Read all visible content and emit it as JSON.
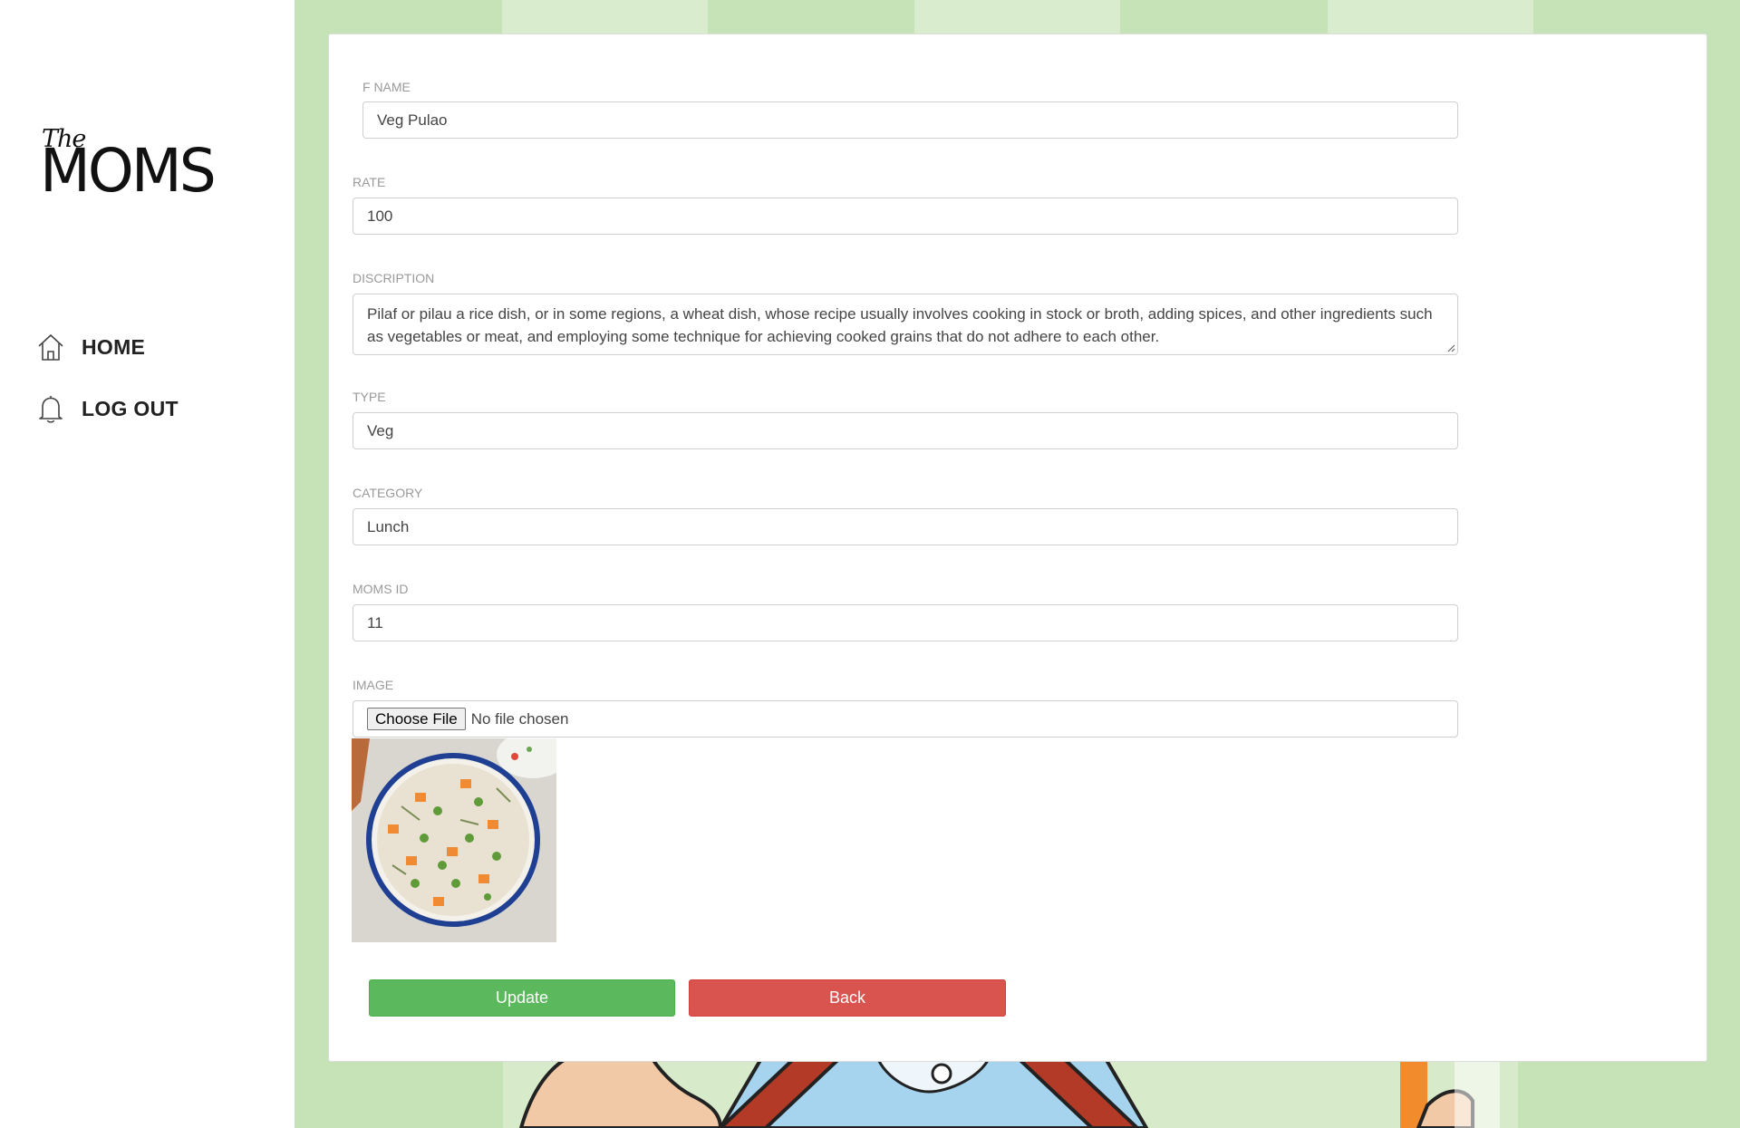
{
  "brand": {
    "logo_small": "The",
    "logo_main": "MOMS"
  },
  "nav": {
    "items": [
      {
        "label": "HOME",
        "icon": "home-icon"
      },
      {
        "label": "LOG OUT",
        "icon": "bell-icon"
      }
    ]
  },
  "form": {
    "fname_label": "F NAME",
    "fname_value": "Veg Pulao",
    "rate_label": "RATE",
    "rate_value": "100",
    "description_label": "DISCRIPTION",
    "description_value": "Pilaf or pilau a rice dish, or in some regions, a wheat dish, whose recipe usually involves cooking in stock or broth, adding spices, and other ingredients such as vegetables or meat, and employing some technique for achieving cooked grains that do not adhere to each other.",
    "type_label": "TYPE",
    "type_value": "Veg",
    "category_label": "CATEGORY",
    "category_value": "Lunch",
    "moms_id_label": "MOMS ID",
    "moms_id_value": "11",
    "image_label": "IMAGE",
    "file_button": "Choose File",
    "file_status": "No file chosen",
    "update_button": "Update",
    "back_button": "Back"
  },
  "colors": {
    "background_green": "#c5e3b6",
    "update_green": "#5cb85c",
    "back_red": "#d9534f"
  }
}
